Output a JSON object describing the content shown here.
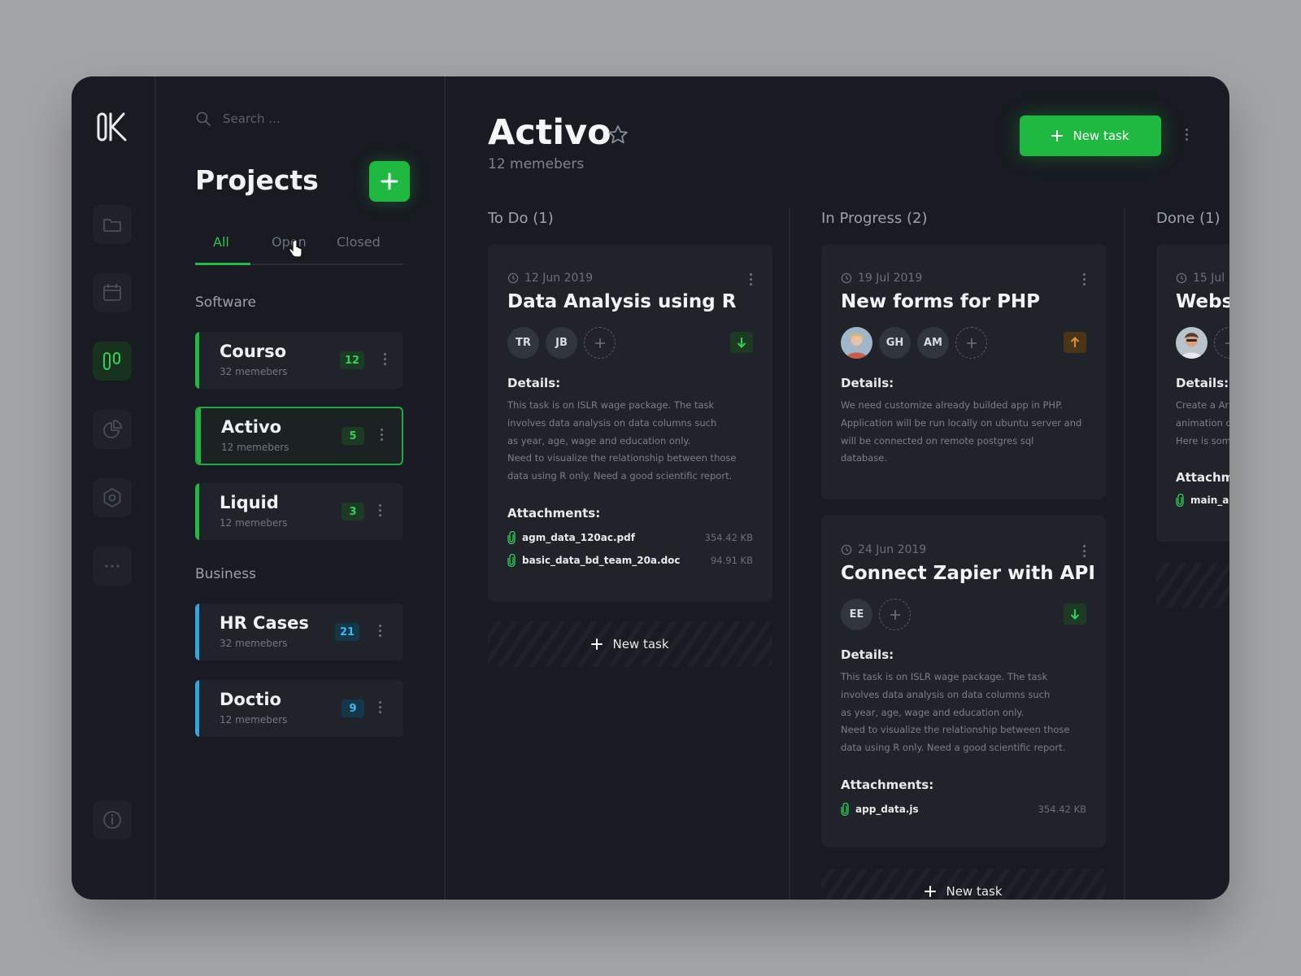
{
  "search": {
    "placeholder": "Search ..."
  },
  "sidebar": {
    "title": "Projects",
    "tabs": [
      {
        "label": "All"
      },
      {
        "label": "Open"
      },
      {
        "label": "Closed"
      }
    ],
    "groups": [
      {
        "label": "Software",
        "projects": [
          {
            "name": "Courso",
            "members": "32 memebers",
            "count": "12"
          },
          {
            "name": "Activo",
            "members": "12 memebers",
            "count": "5"
          },
          {
            "name": "Liquid",
            "members": "12 memebers",
            "count": "3"
          }
        ]
      },
      {
        "label": "Business",
        "projects": [
          {
            "name": "HR Cases",
            "members": "32 memebers",
            "count": "21"
          },
          {
            "name": "Doctio",
            "members": "12 memebers",
            "count": "9"
          }
        ]
      }
    ]
  },
  "board": {
    "title": "Activo",
    "members": "12 memebers",
    "new_task_label": "New task",
    "columns": [
      {
        "title": "To Do (1)",
        "cards": [
          {
            "date": "12 Jun 2019",
            "title": "Data Analysis using R",
            "assignees": [
              "TR",
              "JB"
            ],
            "priority": "down",
            "details_label": "Details:",
            "details": "This task is on ISLR wage package. The task\ninvolves data analysis on data columns such\nas year, age, wage and education only.\nNeed to visualize the relationship between those\ndata using R only. Need a good scientific report.",
            "attachments_label": "Attachments:",
            "attachments": [
              {
                "name": "agm_data_120ac.pdf",
                "size": "354.42 KB"
              },
              {
                "name": "basic_data_bd_team_20a.doc",
                "size": "94.91 KB"
              }
            ]
          }
        ],
        "new_task_label": "New task"
      },
      {
        "title": "In Progress (2)",
        "cards": [
          {
            "date": "19 Jul 2019",
            "title": "New forms for PHP",
            "assignees": [
              "GH",
              "AM"
            ],
            "priority": "up",
            "details_label": "Details:",
            "details": "We need customize already builded app in PHP.\nApplication will be run locally on ubuntu server and\nwill be connected on remote postgres sql\ndatabase."
          },
          {
            "date": "24 Jun 2019",
            "title": "Connect Zapier with API",
            "assignees": [
              "EE"
            ],
            "priority": "down",
            "details_label": "Details:",
            "details": "This task is on ISLR wage package. The task\ninvolves data analysis on data columns such\nas year, age, wage and education only.\nNeed to visualize the relationship between those\ndata using R only. Need a good scientific report.",
            "attachments_label": "Attachments:",
            "attachments": [
              {
                "name": "app_data.js",
                "size": "354.42 KB"
              }
            ]
          }
        ],
        "new_task_label": "New task"
      },
      {
        "title": "Done (1)",
        "cards": [
          {
            "date": "15 Jul",
            "title": "Websi",
            "details_label": "Details:",
            "details": "Create a Ar\nanimation c\nHere is som",
            "attachments_label": "Attachme",
            "attachments": [
              {
                "name": "main_ar"
              }
            ]
          }
        ]
      }
    ]
  },
  "colors": {
    "accent": "#1fb840",
    "business_accent": "#2fa8e0",
    "priority_up": "#e0902a"
  }
}
